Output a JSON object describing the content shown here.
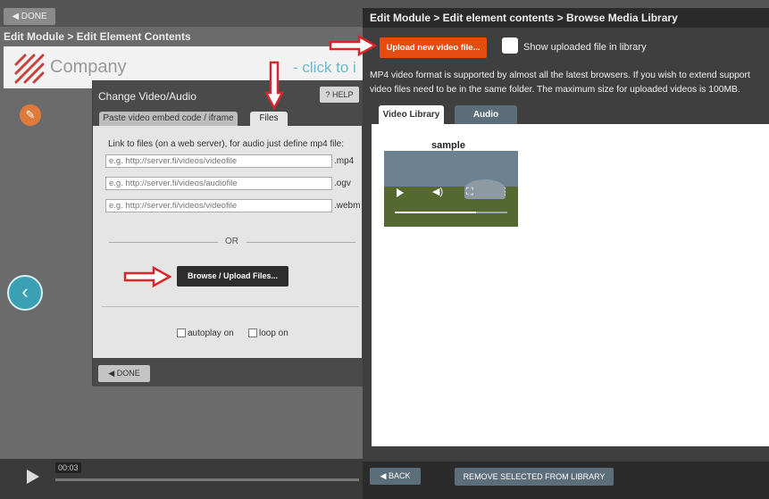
{
  "background": {
    "done_label": "◀ DONE",
    "breadcrumb": "Edit Module > Edit Element Contents",
    "logo_text": "Company",
    "click_hint": "- click to i",
    "time": "00:03"
  },
  "dialog": {
    "title": "Change Video/Audio",
    "help_label": "? HELP",
    "tabs": [
      {
        "label": "Paste video embed code / iframe"
      },
      {
        "label": "Files"
      }
    ],
    "hint": "Link to files (on a web server), for audio just define mp4 file:",
    "inputs": [
      {
        "placeholder": "e.g. http://server.fi/videos/videofile",
        "ext": ".mp4"
      },
      {
        "placeholder": "e.g. http://server.fi/videos/audiofile",
        "ext": ".ogv"
      },
      {
        "placeholder": "e.g. http://server.fi/videos/videofile",
        "ext": ".webm"
      }
    ],
    "or_label": "OR",
    "browse_label": "Browse / Upload Files...",
    "autoplay_label": "autoplay on",
    "loop_label": "loop on",
    "done_label": "◀ DONE"
  },
  "library": {
    "breadcrumb": "Edit Module > Edit element contents > Browse Media Library",
    "upload_label": "Upload new video file...",
    "show_uploaded_label": "Show uploaded file in library",
    "info_line1": "MP4 video format is supported by almost all the latest browsers. If you wish to extend support",
    "info_line2": "video files need to be in the same folder. The maximum size for uploaded videos is 100MB.",
    "tabs": [
      {
        "label": "Video Library"
      },
      {
        "label": "Audio"
      }
    ],
    "items": [
      {
        "title": "sample",
        "progress": 0.72
      }
    ],
    "back_label": "◀ BACK",
    "remove_label": "REMOVE SELECTED FROM LIBRARY"
  },
  "colors": {
    "accent_orange": "#e44d12",
    "arrow_red": "#d9262b",
    "teal": "#3aa0b4"
  }
}
